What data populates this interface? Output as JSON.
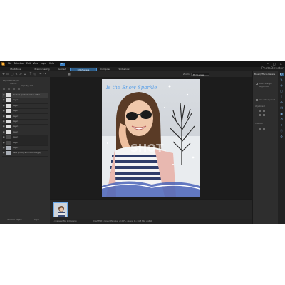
{
  "menu": [
    "File",
    "Selection",
    "Edit",
    "View",
    "Layer",
    "Help"
  ],
  "version_badge": "V8",
  "window_controls": [
    "–",
    "□",
    "×"
  ],
  "brand": "PhotoDirector",
  "tabs": [
    {
      "label": "Multi-tone"
    },
    {
      "label": "Preprocessing"
    },
    {
      "label": "Guided"
    },
    {
      "label": "Edit/Layers",
      "active": true
    },
    {
      "label": "Compose"
    },
    {
      "label": "Slideshow"
    }
  ],
  "toolbar": {
    "icons": [
      "move-icon",
      "select-icon",
      "lasso-icon",
      "brush-icon",
      "eraser-icon",
      "crop-icon",
      "text-icon",
      "shape-icon",
      "undo-icon",
      "redo-icon",
      "grid-icon"
    ],
    "zoom_label": "Zoom",
    "zoom_value": "Fit to view"
  },
  "layers_panel": {
    "header": "Layer Manager",
    "blend_mode": "Normal",
    "opacity": "Opacity: 100",
    "layers": [
      {
        "name": "* A dark gradient with a softer...",
        "tone": "light"
      },
      {
        "name": "Layer 9",
        "tone": "light"
      },
      {
        "name": "Layer 8",
        "tone": "light"
      },
      {
        "name": "Layer 7",
        "tone": "light"
      },
      {
        "name": "Layer 6",
        "tone": "light"
      },
      {
        "name": "Layer 5",
        "tone": "light"
      },
      {
        "name": "Layer 4",
        "tone": "light"
      },
      {
        "name": "Layer 3",
        "tone": "light"
      },
      {
        "name": "Layer 2",
        "tone": "dark"
      },
      {
        "name": "Layer 1",
        "tone": "dark"
      },
      {
        "name": "Layer 0",
        "tone": "photo"
      },
      {
        "name": "Base photograph (400x500).jpg",
        "tone": "photo"
      }
    ],
    "footer_left": "Shortcut Layers",
    "footer_right": "Layer"
  },
  "canvas": {
    "overlay_text_top": "Is the Snow Sparkle",
    "overlay_text_mid": "SHOT"
  },
  "status": {
    "left": "1 image(s)/file  1 image(s)",
    "mid": "Brush/Edit • Layer Manager • 100%  •  Layer 0  •  RGB 8bit  •  sRGB",
    "right": ""
  },
  "right_panel": {
    "title": "Brush/Effects Details",
    "item1": "Effect strength",
    "item2": "Brightness",
    "checkbox_label": "Use default preset",
    "section1": "Adjustment",
    "section2": "Shadows"
  },
  "side_strip_icons": [
    "adjust-icon",
    "brush-icon",
    "filter-icon",
    "frame-icon",
    "text-icon",
    "sticker-icon",
    "layer-icon",
    "mask-icon",
    "history-icon",
    "export-icon",
    "info-icon",
    "settings-icon"
  ],
  "colors": {
    "accent": "#2f5f8a",
    "canvas_bg": "#1c1c1c",
    "panel_bg": "#2e2e2e"
  }
}
